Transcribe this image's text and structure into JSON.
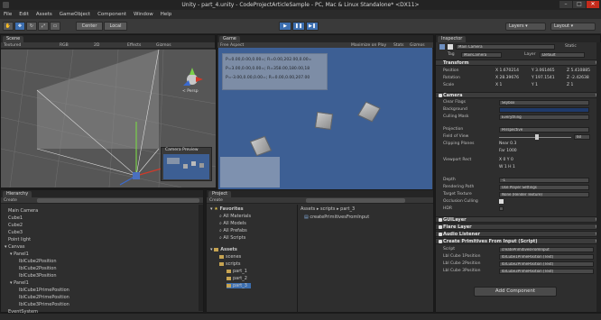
{
  "titlebar": {
    "title": "Unity - part_4.unity - CodeProjectArticleSample - PC, Mac & Linux Standalone* <DX11>",
    "min": "–",
    "max": "□",
    "close": "✕"
  },
  "menu": [
    "File",
    "Edit",
    "Assets",
    "GameObject",
    "Component",
    "Window",
    "Help"
  ],
  "toolbar": {
    "center": "Center",
    "local": "Local",
    "play": "▶",
    "pause": "❚❚",
    "step": "▶❚",
    "layers": "Layers",
    "layout": "Layout"
  },
  "scene": {
    "tab": "Scene",
    "mode": "Textured",
    "render": "RGB",
    "twod": "2D",
    "effects": "Effects",
    "gizmos": "Gizmos",
    "persp": "< Persp",
    "camera_preview": "Camera Preview",
    "cam_label": "Main Camera"
  },
  "game": {
    "tab": "Game",
    "aspect": "Free Aspect",
    "maximize": "Maximize on Play",
    "stats": "Stats",
    "gizmos": "Gizmos",
    "lines": [
      "P=0.00,0.00,0.00=; R=0.00,202.00,0.00=",
      "P=3.00,0.00,0.00=; R=358.00,180.00,18",
      "P=-3.00,0.00,0.00=; R=0.00,0.00,207.00"
    ]
  },
  "hierarchy": {
    "tab": "Hierarchy",
    "create": "Create",
    "items": [
      "Main Camera",
      "Cube1",
      "Cube2",
      "Cube3",
      "Point light",
      "Canvas",
      "Panel1",
      "lblCube2Position",
      "lblCube2Position",
      "lblCube3Position",
      "Panel1",
      "lblCube1PrimePosition",
      "lblCube2PrimePosition",
      "lblCube3PrimePosition",
      "EventSystem"
    ]
  },
  "project": {
    "tab": "Project",
    "create": "Create",
    "breadcrumb": "Assets ▸ scripts ▸ part_3",
    "file": "createPrimitivesFromInput",
    "favorites": "Favorites",
    "fav_items": [
      "All Materials",
      "All Models",
      "All Prefabs",
      "All Scripts"
    ],
    "assets": "Assets",
    "asset_items": [
      "scenes",
      "scripts",
      "part_1",
      "part_2",
      "part_3"
    ]
  },
  "inspector": {
    "tab": "Inspector",
    "name": "Main Camera",
    "static": "Static",
    "tag_label": "Tag",
    "tag": "MainCamera",
    "layer_label": "Layer",
    "layer": "Default",
    "transform": "Transform",
    "pos_label": "Position",
    "rot_label": "Rotation",
    "scale_label": "Scale",
    "pos": [
      "X 1.670214",
      "Y 3.061465",
      "Z 5.410885"
    ],
    "rot": [
      "X 28.39676",
      "Y 197.1541",
      "Z -2.42638"
    ],
    "scale": [
      "X 1",
      "Y 1",
      "Z 1"
    ],
    "camera": "Camera",
    "cam_rows": [
      [
        "Clear Flags",
        "Skybox"
      ],
      [
        "Background",
        ""
      ],
      [
        "Culling Mask",
        "Everything"
      ],
      [
        "",
        ""
      ],
      [
        "Projection",
        "Perspective"
      ],
      [
        "Field of View",
        "60"
      ],
      [
        "Clipping Planes",
        "Near 0.3"
      ],
      [
        "",
        "Far 1000"
      ],
      [
        "Viewport Rect",
        "X 0        Y 0"
      ],
      [
        "",
        "W 1        H 1"
      ],
      [
        "",
        ""
      ],
      [
        "Depth",
        "-1"
      ],
      [
        "Rendering Path",
        "Use Player Settings"
      ],
      [
        "Target Texture",
        "None (Render Texture)"
      ],
      [
        "Occlusion Culling",
        ""
      ],
      [
        "HDR",
        ""
      ]
    ],
    "gui_layer": "GUILayer",
    "flare_layer": "Flare Layer",
    "audio_listener": "Audio Listener",
    "script_comp": "Create Primitives From Input (Script)",
    "script_rows": [
      [
        "Script",
        "createPrimitivesFromInput"
      ],
      [
        "Lbl Cube 1Position",
        "lblCube1PrimePosition (Text)"
      ],
      [
        "Lbl Cube 2Position",
        "lblCube2PrimePosition (Text)"
      ],
      [
        "Lbl Cube 3Position",
        "lblCube3PrimePosition (Text)"
      ]
    ],
    "add_component": "Add Component"
  },
  "colors": {
    "accent": "#3d6fb0",
    "game_bg": "#3d5f94"
  }
}
